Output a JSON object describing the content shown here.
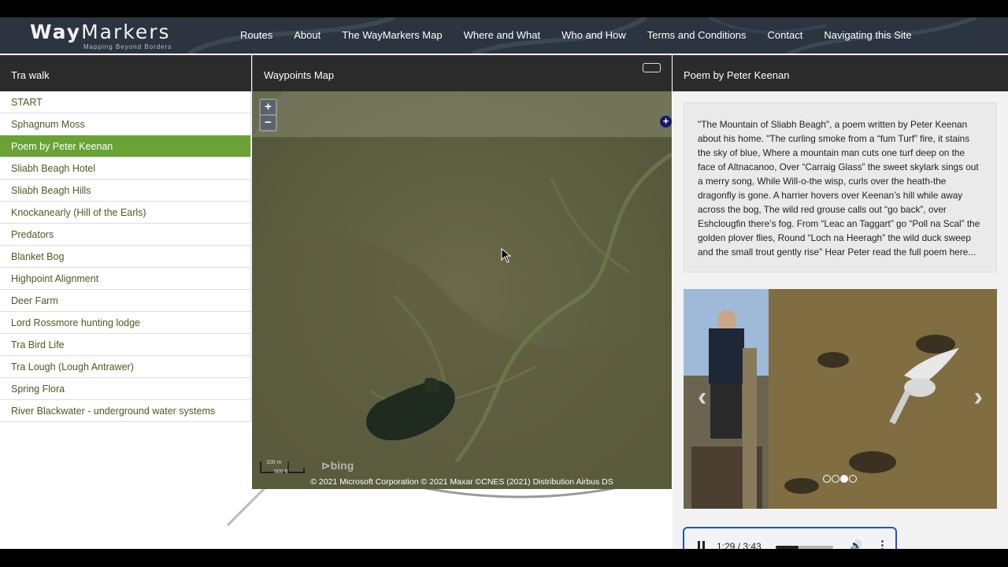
{
  "header": {
    "logo_bold": "Way",
    "logo_light": "Markers",
    "tagline": "Mapping Beyond Borders",
    "nav": [
      "Routes",
      "About",
      "The WayMarkers Map",
      "Where and What",
      "Who and How",
      "Terms and Conditions",
      "Contact",
      "Navigating this Site"
    ]
  },
  "left_panel": {
    "title": "Tra walk",
    "items": [
      "START",
      "Sphagnum Moss",
      "Poem by Peter Keenan",
      "Sliabh Beagh Hotel",
      "Sliabh Beagh Hills",
      "Knockanearly (Hill of the Earls)",
      "Predators",
      "Blanket Bog",
      "Highpoint Alignment",
      "Deer Farm",
      "Lord Rossmore hunting lodge",
      "Tra Bird Life",
      "Tra Lough (Lough Antrawer)",
      "Spring Flora",
      "River Blackwater - underground water systems"
    ],
    "active_index": 2
  },
  "map_panel": {
    "title": "Waypoints Map",
    "zoom_in": "+",
    "zoom_out": "−",
    "add_tool": "+",
    "scale_top": "100 m",
    "scale_bottom": "500 ft",
    "provider": "bing",
    "copyright": "© 2021 Microsoft Corporation © 2021 Maxar ©CNES (2021) Distribution Airbus DS"
  },
  "right_panel": {
    "title": "Poem by Peter Keenan",
    "poem_text": "\"The Mountain of Sliabh Beagh\", a poem written by Peter Keenan about his home. \"The curling smoke from a “fum Turf” fire, it stains the sky of blue, Where a mountain man cuts one turf deep on the face of Altnacanoo, Over “Carraig Glass” the sweet skylark sings out a merry song, While Will-o-the wisp, curls over the heath-the dragonfly is gone. A harrier hovers over Keenan’s hill while away across the bog, The wild red grouse calls out “go back”, over Eshclougfin there’s fog. From “Leac an Taggart” go “Poll na Scal” the golden plover flies, Round “Loch na Heeragh” the wild duck sweep and the small trout gently rise\" Hear Peter read the full poem here...",
    "carousel": {
      "prev": "‹",
      "next": "›",
      "slide_count": 4,
      "active_slide": 2
    },
    "audio": {
      "time": "1:29 / 3:43",
      "progress": 0.4,
      "volume_icon": "🔊",
      "more_icon": "⋮"
    }
  },
  "colors": {
    "header_bg": "#2b3440",
    "panel_head_bg": "#2b2b2b",
    "active_item": "#6aa235",
    "link_text": "#4d5a22"
  }
}
